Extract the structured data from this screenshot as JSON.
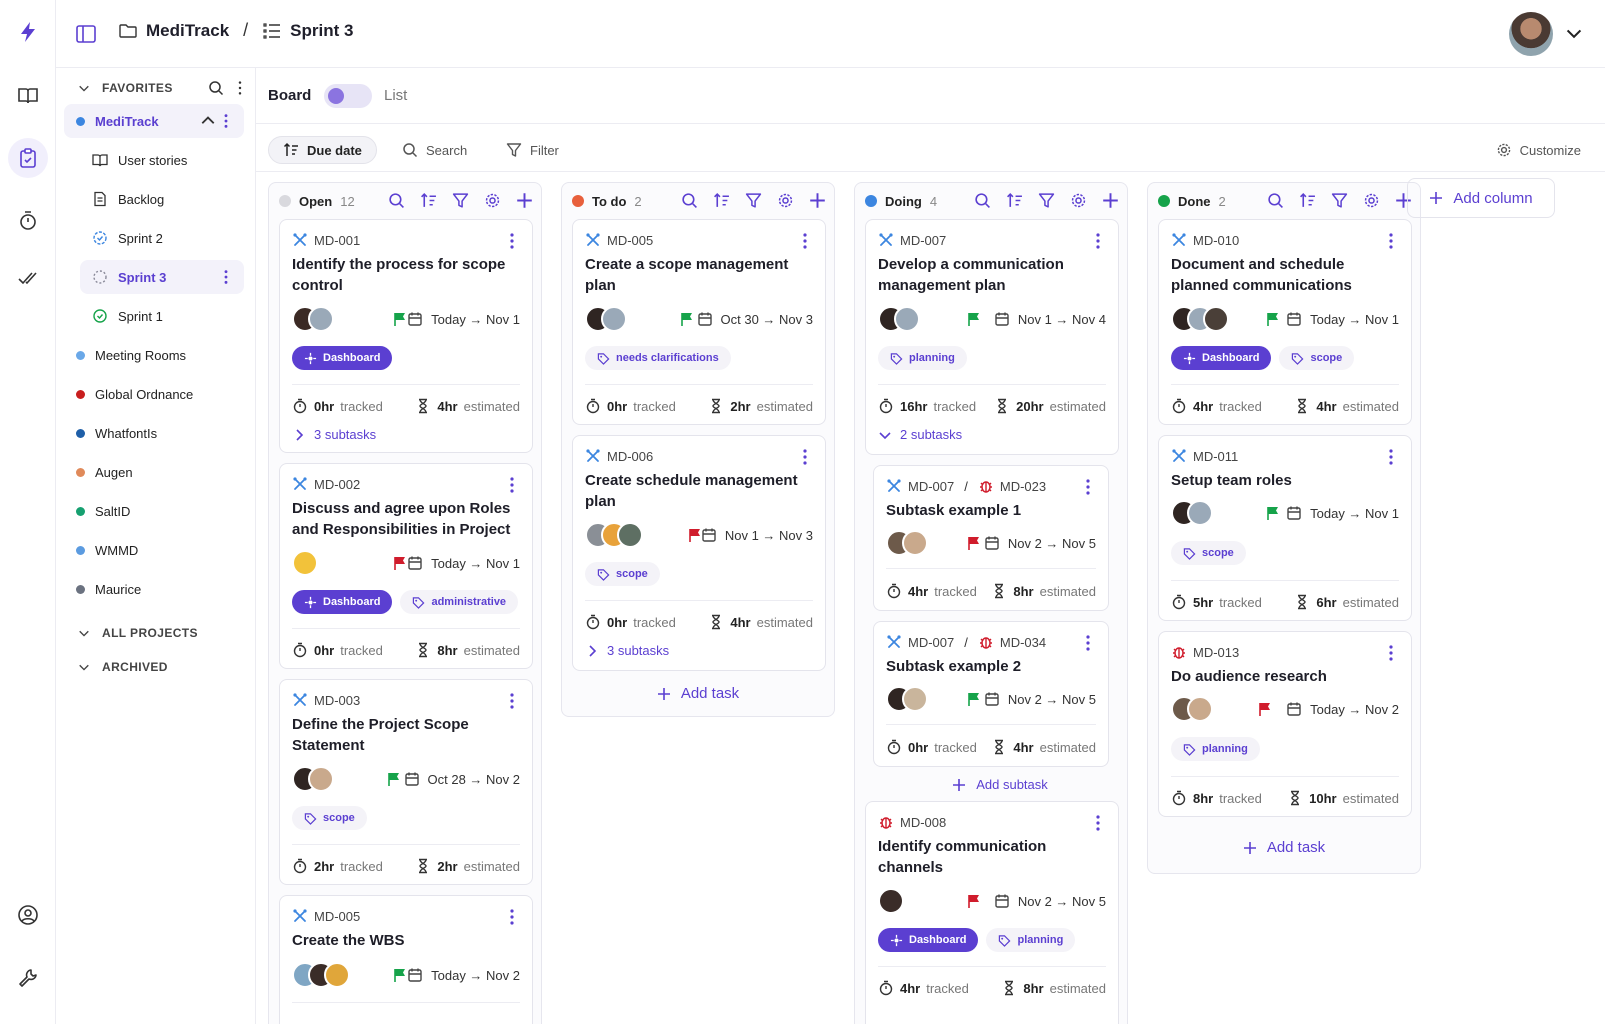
{
  "colors": {
    "accent": "#5b3fd1",
    "open": "#d9d9de",
    "todo": "#e8603c",
    "doing": "#3c86e0",
    "done": "#16a34a",
    "flag_green": "#16a34a",
    "flag_red": "#d01c2c"
  },
  "header": {
    "project": "MediTrack",
    "sprint": "Sprint 3",
    "separator": "/"
  },
  "sidebar": {
    "favorites_label": "FAVORITES",
    "all_projects_label": "ALL PROJECTS",
    "archived_label": "ARCHIVED",
    "active_project": "MediTrack",
    "children": [
      {
        "label": "User stories"
      },
      {
        "label": "Backlog"
      },
      {
        "label": "Sprint 2"
      },
      {
        "label": "Sprint 3"
      },
      {
        "label": "Sprint 1"
      }
    ],
    "projects": [
      {
        "label": "Meeting Rooms",
        "color": "#6aa8e8"
      },
      {
        "label": "Global Ordnance",
        "color": "#c81e1e"
      },
      {
        "label": "WhatfontIs",
        "color": "#1f5fa8"
      },
      {
        "label": "Augen",
        "color": "#e08a5a"
      },
      {
        "label": "SaltID",
        "color": "#16a070"
      },
      {
        "label": "WMMD",
        "color": "#5b9be0"
      },
      {
        "label": "Maurice",
        "color": "#6b7280"
      }
    ]
  },
  "viewbar": {
    "board": "Board",
    "list": "List"
  },
  "toolbar": {
    "due_date": "Due date",
    "search": "Search",
    "filter": "Filter",
    "customize": "Customize"
  },
  "columns": [
    {
      "name": "Open",
      "count": "12"
    },
    {
      "name": "To do",
      "count": "2"
    },
    {
      "name": "Doing",
      "count": "4"
    },
    {
      "name": "Done",
      "count": "2"
    }
  ],
  "add_column": "Add column",
  "add_task": "Add task",
  "add_subtask": "Add subtask",
  "tracked_word": "tracked",
  "estimated_word": "estimated",
  "cards": {
    "md001": {
      "id": "MD-001",
      "title": "Identify the process for scope control",
      "dates": "Today → Nov 1",
      "tag1": "Dashboard",
      "tracked": "0hr",
      "estimated": "4hr",
      "subtasks": "3 subtasks"
    },
    "md002": {
      "id": "MD-002",
      "title": "Discuss and agree upon Roles and Responsibilities in Project",
      "dates": "Today → Nov 1",
      "tag1": "Dashboard",
      "tag2": "administrative",
      "tracked": "0hr",
      "estimated": "8hr"
    },
    "md003": {
      "id": "MD-003",
      "title": "Define the Project Scope Statement",
      "dates": "Oct 28 → Nov 2",
      "tag1": "scope",
      "tracked": "2hr",
      "estimated": "2hr"
    },
    "md005b": {
      "id": "MD-005",
      "title": "Create the WBS",
      "dates": "Today → Nov 2"
    },
    "md005": {
      "id": "MD-005",
      "title": "Create a scope management plan",
      "dates": "Oct 30 → Nov 3",
      "tag1": "needs clarifications",
      "tracked": "0hr",
      "estimated": "2hr"
    },
    "md006": {
      "id": "MD-006",
      "title": "Create schedule management plan",
      "dates": "Nov 1 → Nov 3",
      "tag1": "scope",
      "tracked": "0hr",
      "estimated": "4hr",
      "subtasks": "3 subtasks"
    },
    "md007": {
      "id": "MD-007",
      "title": "Develop a communication management plan",
      "dates": "Nov 1 → Nov 4",
      "tag1": "planning",
      "tracked": "16hr",
      "estimated": "20hr",
      "subtasks": "2 subtasks"
    },
    "md023": {
      "parent": "MD-007",
      "id": "MD-023",
      "title": "Subtask example 1",
      "dates": "Nov 2 → Nov 5",
      "tracked": "4hr",
      "estimated": "8hr"
    },
    "md034": {
      "parent": "MD-007",
      "id": "MD-034",
      "title": "Subtask example 2",
      "dates": "Nov 2 → Nov 5",
      "tracked": "0hr",
      "estimated": "4hr"
    },
    "md008": {
      "id": "MD-008",
      "title": "Identify communication channels",
      "dates": "Nov 2 → Nov 5",
      "tag1": "Dashboard",
      "tag2": "planning",
      "tracked": "4hr",
      "estimated": "8hr"
    },
    "md010": {
      "id": "MD-010",
      "title": "Document and schedule planned communications",
      "dates": "Today → Nov 1",
      "tag1": "Dashboard",
      "tag2": "scope",
      "tracked": "4hr",
      "estimated": "4hr"
    },
    "md011": {
      "id": "MD-011",
      "title": "Setup team roles",
      "dates": "Today → Nov 1",
      "tag1": "scope",
      "tracked": "5hr",
      "estimated": "6hr"
    },
    "md013": {
      "id": "MD-013",
      "title": "Do audience research",
      "dates": "Today → Nov 2",
      "tag1": "planning",
      "tracked": "8hr",
      "estimated": "10hr"
    }
  }
}
